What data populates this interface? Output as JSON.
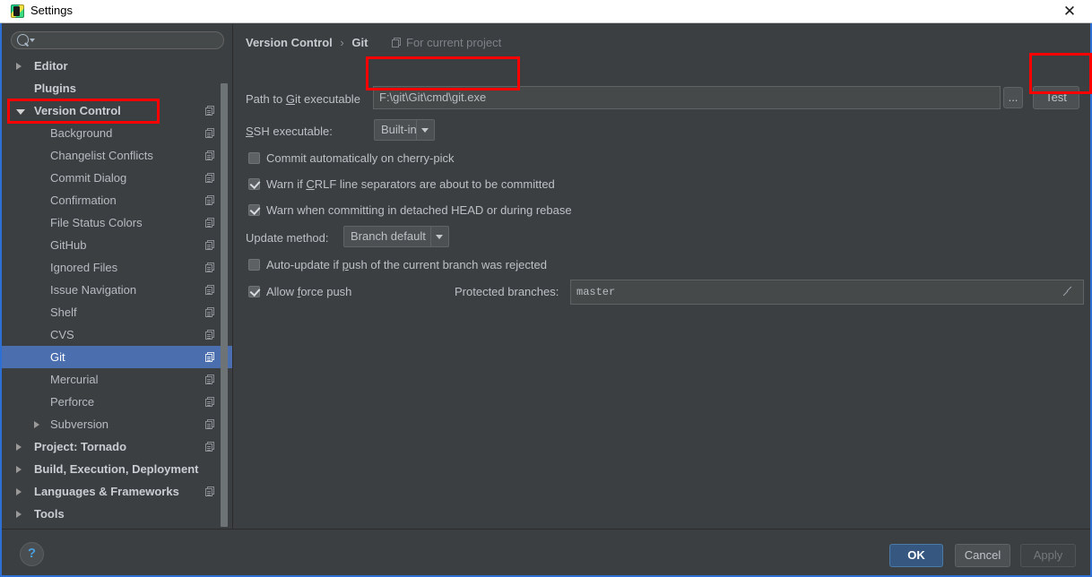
{
  "window": {
    "title": "Settings",
    "close_label": "✕",
    "app_icon": "pycharm-icon"
  },
  "sidebar": {
    "search": {
      "placeholder": "",
      "value": "",
      "icon": "search-icon"
    },
    "items": [
      {
        "label": "Editor",
        "level": 0,
        "arrow": "right",
        "bold": true,
        "cfg": false,
        "selected": false
      },
      {
        "label": "Plugins",
        "level": 0,
        "arrow": "none",
        "bold": true,
        "cfg": false,
        "selected": false
      },
      {
        "label": "Version Control",
        "level": 0,
        "arrow": "down",
        "bold": true,
        "cfg": true,
        "selected": false
      },
      {
        "label": "Background",
        "level": 1,
        "arrow": "none",
        "bold": false,
        "cfg": true,
        "selected": false
      },
      {
        "label": "Changelist Conflicts",
        "level": 1,
        "arrow": "none",
        "bold": false,
        "cfg": true,
        "selected": false
      },
      {
        "label": "Commit Dialog",
        "level": 1,
        "arrow": "none",
        "bold": false,
        "cfg": true,
        "selected": false
      },
      {
        "label": "Confirmation",
        "level": 1,
        "arrow": "none",
        "bold": false,
        "cfg": true,
        "selected": false
      },
      {
        "label": "File Status Colors",
        "level": 1,
        "arrow": "none",
        "bold": false,
        "cfg": true,
        "selected": false
      },
      {
        "label": "GitHub",
        "level": 1,
        "arrow": "none",
        "bold": false,
        "cfg": true,
        "selected": false
      },
      {
        "label": "Ignored Files",
        "level": 1,
        "arrow": "none",
        "bold": false,
        "cfg": true,
        "selected": false
      },
      {
        "label": "Issue Navigation",
        "level": 1,
        "arrow": "none",
        "bold": false,
        "cfg": true,
        "selected": false
      },
      {
        "label": "Shelf",
        "level": 1,
        "arrow": "none",
        "bold": false,
        "cfg": true,
        "selected": false
      },
      {
        "label": "CVS",
        "level": 1,
        "arrow": "none",
        "bold": false,
        "cfg": true,
        "selected": false
      },
      {
        "label": "Git",
        "level": 1,
        "arrow": "none",
        "bold": false,
        "cfg": true,
        "selected": true
      },
      {
        "label": "Mercurial",
        "level": 1,
        "arrow": "none",
        "bold": false,
        "cfg": true,
        "selected": false
      },
      {
        "label": "Perforce",
        "level": 1,
        "arrow": "none",
        "bold": false,
        "cfg": true,
        "selected": false
      },
      {
        "label": "Subversion",
        "level": 1,
        "arrow": "right",
        "bold": false,
        "cfg": true,
        "selected": false
      },
      {
        "label": "Project: Tornado",
        "level": 0,
        "arrow": "right",
        "bold": true,
        "cfg": true,
        "selected": false
      },
      {
        "label": "Build, Execution, Deployment",
        "level": 0,
        "arrow": "right",
        "bold": true,
        "cfg": false,
        "selected": false
      },
      {
        "label": "Languages & Frameworks",
        "level": 0,
        "arrow": "right",
        "bold": true,
        "cfg": true,
        "selected": false
      },
      {
        "label": "Tools",
        "level": 0,
        "arrow": "right",
        "bold": true,
        "cfg": false,
        "selected": false
      }
    ]
  },
  "main": {
    "breadcrumb": {
      "root": "Version Control",
      "separator": "›",
      "leaf": "Git",
      "scope": "For current project",
      "scope_icon": "project-scope-icon"
    },
    "git_path": {
      "label": "Path to ",
      "label_mnemonic": "G",
      "label_rest": "it executable",
      "value": "F:\\git\\Git\\cmd\\git.exe",
      "browse_label": "...",
      "test_label": "Test"
    },
    "ssh": {
      "label_mnemonic": "S",
      "label_rest": "SH executable:",
      "value": "Built-in",
      "arrow_icon": "chevron-down-icon"
    },
    "checkboxes": [
      {
        "label_pre": "Commit automatically on cherry-pick",
        "mnemonic": "",
        "label_post": "",
        "checked": false
      },
      {
        "label_pre": "Warn if ",
        "mnemonic": "C",
        "label_post": "RLF line separators are about to be committed",
        "checked": true
      },
      {
        "label_pre": "Warn when committing in detached HEAD or during rebase",
        "mnemonic": "",
        "label_post": "",
        "checked": true
      }
    ],
    "update_method": {
      "label": "Update method:",
      "value": "Branch default",
      "arrow_icon": "chevron-down-icon"
    },
    "auto_update": {
      "label_pre": "Auto-update if ",
      "mnemonic": "p",
      "label_post": "ush of the current branch was rejected",
      "checked": false
    },
    "force_push": {
      "label_pre": "Allow ",
      "mnemonic": "f",
      "label_post": "orce push",
      "checked": true
    },
    "protected_branches": {
      "label": "Protected branches:",
      "value": "master",
      "expand_icon": "expand-icon"
    }
  },
  "footer": {
    "help_label": "?",
    "ok_label": "OK",
    "cancel_label": "Cancel",
    "apply_label": "Apply"
  },
  "annotations": {
    "highlight_color": "#ff0000",
    "boxes": [
      "version-control-sidebar-item",
      "git-path-field",
      "test-button"
    ]
  }
}
